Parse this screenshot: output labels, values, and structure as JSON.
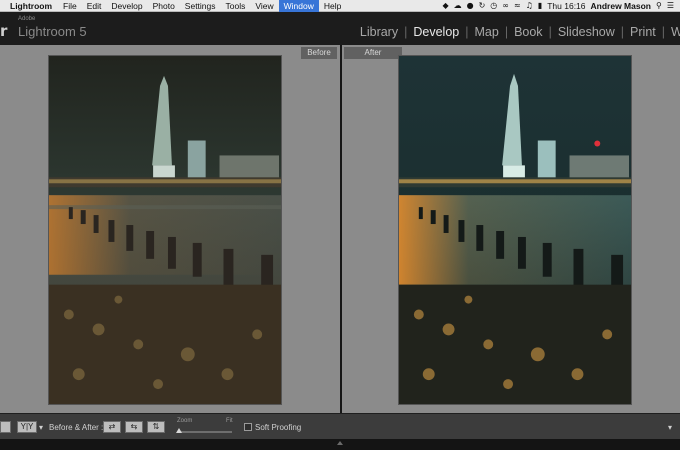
{
  "menubar": {
    "app": "Lightroom",
    "items": [
      "File",
      "Edit",
      "Develop",
      "Photo",
      "Settings",
      "Tools",
      "View",
      "Window",
      "Help"
    ],
    "active_item": "Window",
    "clock": "Thu 16:16",
    "user": "Andrew Mason"
  },
  "header": {
    "brand_small": "Adobe",
    "brand_name": "Lightroom 5",
    "logo_fragment": "r",
    "modules": [
      "Library",
      "Develop",
      "Map",
      "Book",
      "Slideshow",
      "Print",
      "Web"
    ],
    "active_module": "Develop"
  },
  "compare": {
    "before_label": "Before",
    "after_label": "After"
  },
  "toolbar": {
    "view_yy_label": "Y|Y",
    "before_after_label": "Before & After :",
    "zoom_label": "Zoom",
    "fit_label": "Fit",
    "zoom_level": 0.0,
    "soft_proofing_label": "Soft Proofing",
    "soft_proofing_checked": false
  },
  "colors": {
    "accent": "#3875d7",
    "panel_bg": "#8b8b8b",
    "header_bg": "#1c1c1c",
    "toolbar_bg": "#3c3c3c"
  },
  "icons": [
    "apple-menu-icon",
    "wifi-icon",
    "volume-icon",
    "battery-icon",
    "spotlight-icon",
    "list-icon",
    "expand-icon"
  ]
}
